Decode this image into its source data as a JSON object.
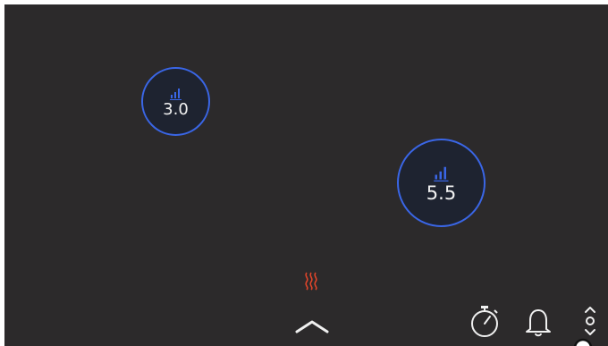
{
  "cooktop": {
    "zones": [
      {
        "value": "3.0",
        "icon": "power-level-icon"
      },
      {
        "value": "5.5",
        "icon": "power-level-icon"
      }
    ],
    "indicators": {
      "heat_icon": "residual-heat-icon",
      "heat_color": "#e0452a"
    },
    "controls": {
      "expand_icon": "chevron-up-icon",
      "timer_icon": "stopwatch-icon",
      "alarm_icon": "bell-icon",
      "adjust_icon": "up-down-adjust-icon"
    }
  },
  "colors": {
    "panel": "#2c2a2b",
    "zone_fill": "#1e2330",
    "zone_ring": "#3a66e6",
    "text": "#f2f2f2",
    "icon": "#f0f0f0"
  }
}
